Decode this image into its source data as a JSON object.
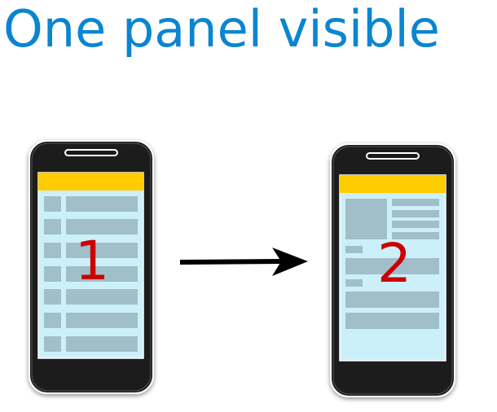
{
  "title": "One panel visible",
  "phones": [
    {
      "panel_number": "1",
      "layout": "list"
    },
    {
      "panel_number": "2",
      "layout": "detail"
    }
  ],
  "colors": {
    "title": "#0a85d2",
    "phone_body": "#1a1a1a",
    "screen": "#ccf0fa",
    "action_bar": "#ffcc00",
    "content_block": "#a1bfc8",
    "panel_number": "#cc0000",
    "arrow": "#000000"
  }
}
